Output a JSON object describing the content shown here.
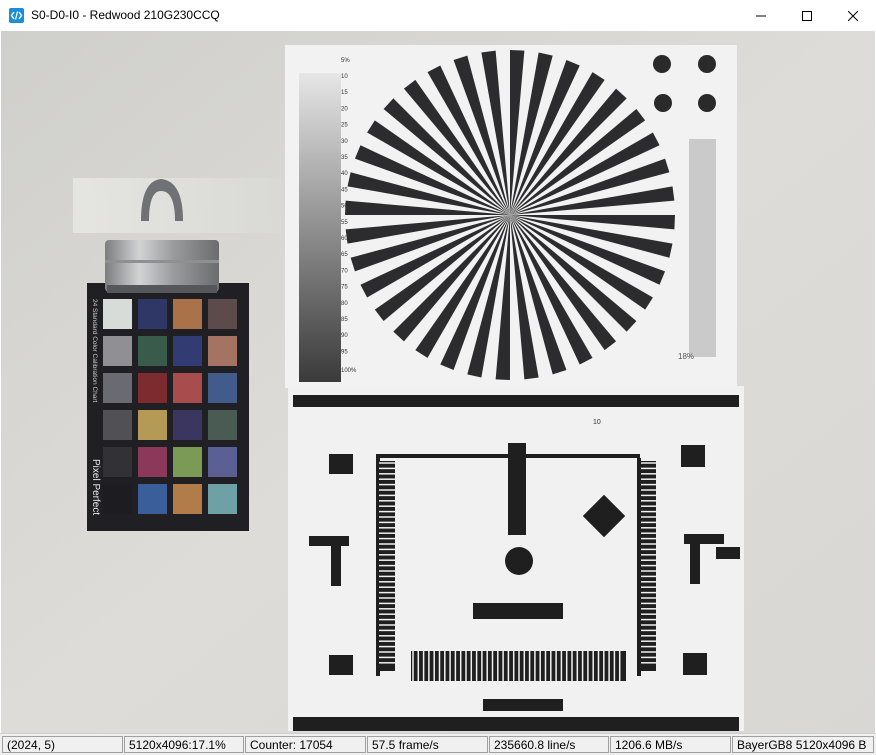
{
  "window": {
    "title": "S0-D0-I0 - Redwood 210G230CCQ",
    "minimize_label": "Minimize",
    "maximize_label": "Maximize",
    "close_label": "Close"
  },
  "icons": {
    "app": "app-code-icon",
    "minimize": "minimize-icon",
    "maximize": "maximize-icon",
    "close": "close-icon"
  },
  "image": {
    "color_chart_label": "24 Standard Color Calibration Chart",
    "brand": "Pixel Perfect",
    "gray_percent_top": "5%",
    "gray_percent_bottom": "100%",
    "right_gray_label": "18%",
    "gray_ticks": [
      "10",
      "15",
      "20",
      "25",
      "30",
      "35",
      "40",
      "45",
      "50",
      "55",
      "60",
      "65",
      "70",
      "75",
      "80",
      "85",
      "90",
      "95"
    ],
    "resolution_number": "10",
    "swatch_colors": [
      "#d7dcd9",
      "#2f3767",
      "#a97249",
      "#5d4a4a",
      "#8f8f94",
      "#395b4c",
      "#323b72",
      "#a47361",
      "#6a6b72",
      "#7c2b2e",
      "#a84c4e",
      "#415b8a",
      "#515155",
      "#b59a55",
      "#3b3660",
      "#495b53",
      "#323236",
      "#8b385a",
      "#7a9a56",
      "#5a6093",
      "#1c1c21",
      "#3a5e99",
      "#b27c4a",
      "#6ea0a6"
    ]
  },
  "status": {
    "coords": "(2024, 5)",
    "resolution_zoom": "5120x4096:17.1%",
    "counter": "Counter: 17054",
    "frame_rate": "57.5 frame/s",
    "line_rate": "235660.8 line/s",
    "bandwidth": "1206.6 MB/s",
    "pixel_format": "BayerGB8 5120x4096 B"
  }
}
